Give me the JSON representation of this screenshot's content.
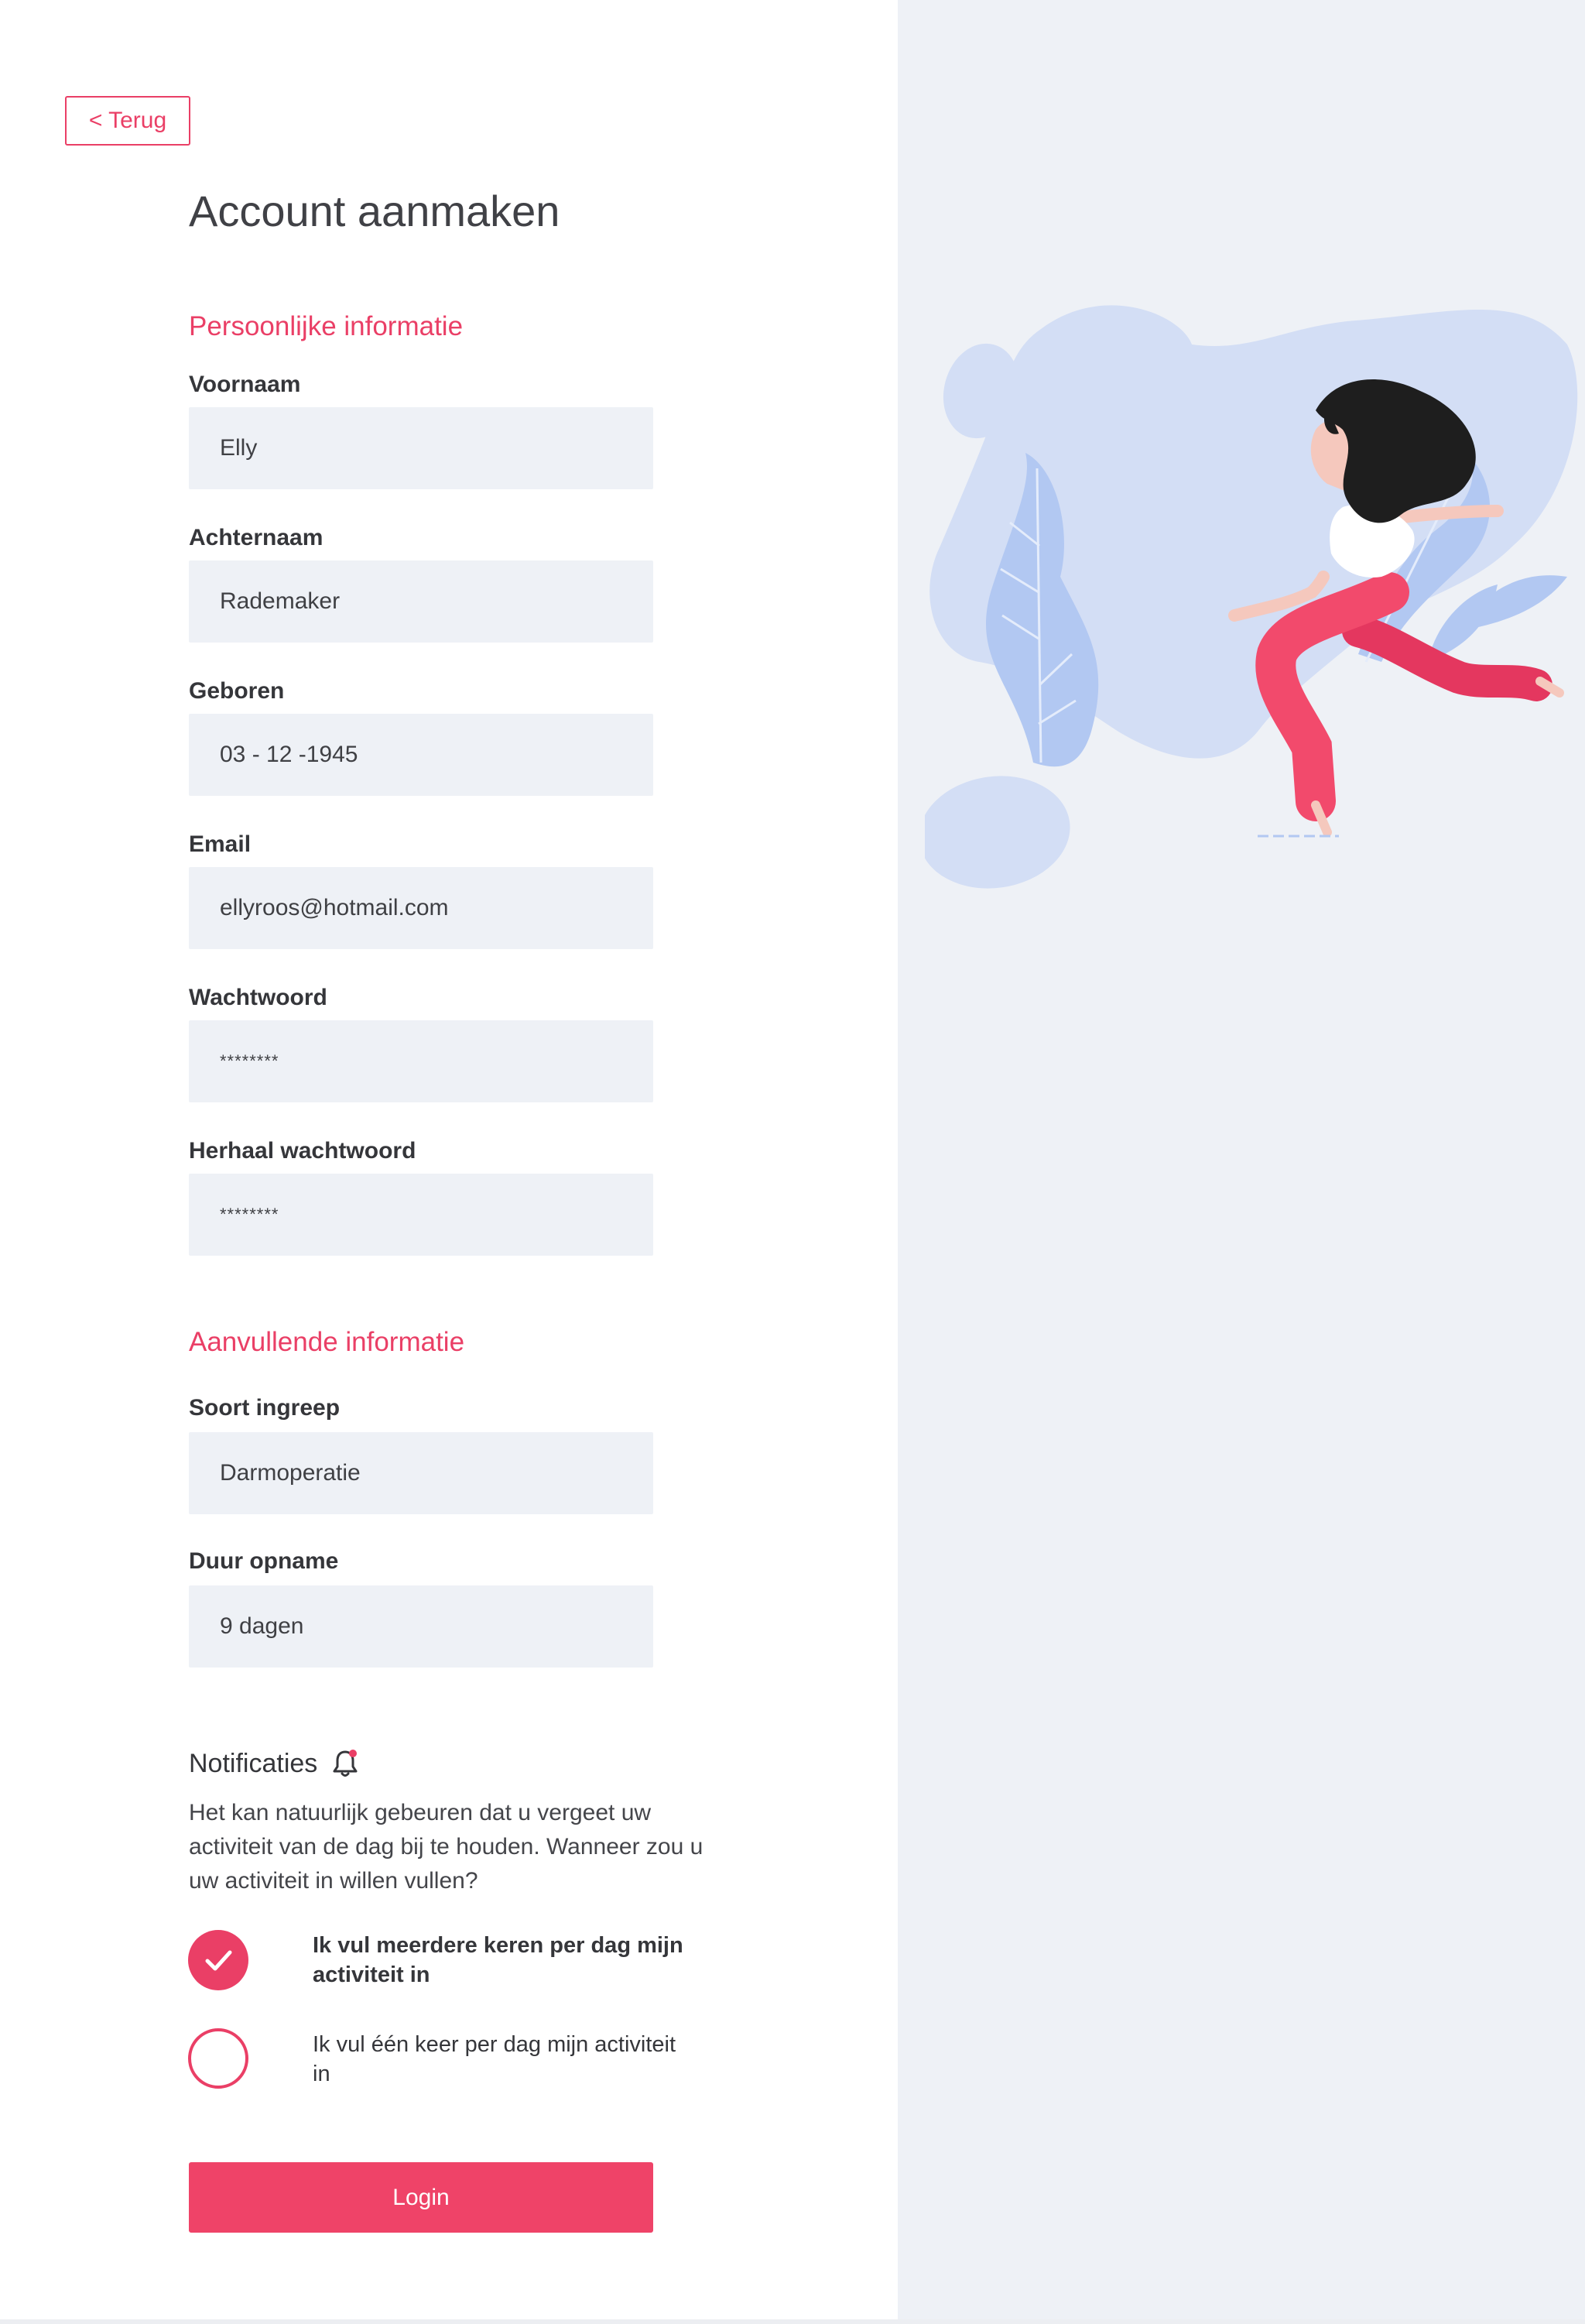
{
  "nav": {
    "back_label": "< Terug"
  },
  "page": {
    "title": "Account aanmaken"
  },
  "personal": {
    "heading": "Persoonlijke informatie",
    "fields": [
      {
        "label": "Voornaam",
        "value": "Elly"
      },
      {
        "label": "Achternaam",
        "value": "Rademaker"
      },
      {
        "label": "Geboren",
        "value": "03 - 12 -1945"
      },
      {
        "label": "Email",
        "value": "ellyroos@hotmail.com"
      },
      {
        "label": "Wachtwoord",
        "value": "********"
      },
      {
        "label": "Herhaal wachtwoord",
        "value": "********"
      }
    ]
  },
  "additional": {
    "heading": "Aanvullende informatie",
    "fields": [
      {
        "label": "Soort ingreep",
        "value": "Darmoperatie"
      },
      {
        "label": "Duur opname",
        "value": "9 dagen"
      }
    ]
  },
  "notifications": {
    "title": "Notificaties",
    "icon": "bell-icon",
    "text": "Het kan natuurlijk gebeuren dat u vergeet uw activiteit van de dag bij te houden. Wanneer zou u uw activiteit in willen vullen?",
    "options": [
      {
        "label": "Ik vul meerdere keren per dag mijn activiteit in",
        "selected": true
      },
      {
        "label": "Ik vul één keer per dag mijn activiteit in",
        "selected": false
      }
    ]
  },
  "actions": {
    "login_label": "Login"
  },
  "colors": {
    "accent": "#ea3f66",
    "field_bg": "#eef1f6",
    "panel_bg": "#eef1f6",
    "blob": "#d3def5",
    "leaf": "#b2c8f2"
  }
}
